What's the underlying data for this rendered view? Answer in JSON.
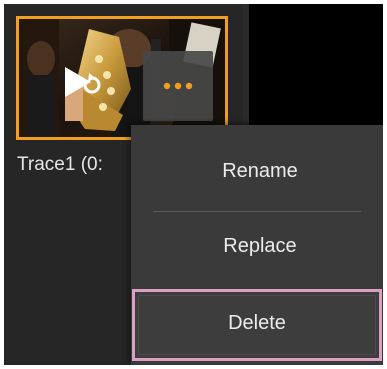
{
  "clip": {
    "label": "Trace1 (0:",
    "play_icon": "play-icon",
    "loop_icon": "loop-icon",
    "more_icon": "more-horizontal-icon",
    "accent_color": "#f0a01e"
  },
  "context_menu": {
    "items": [
      {
        "label": "Rename"
      },
      {
        "label": "Replace"
      },
      {
        "label": "Delete"
      }
    ],
    "highlight_color": "#d9a0c4"
  }
}
